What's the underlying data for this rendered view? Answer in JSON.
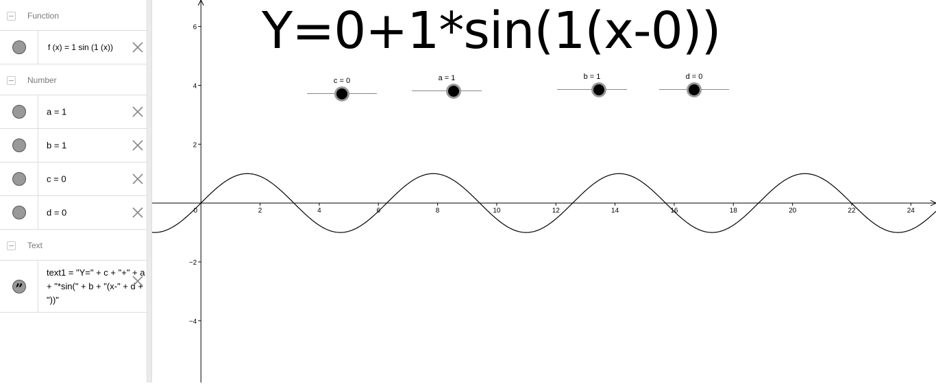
{
  "algebra": {
    "categories": {
      "function": "Function",
      "number": "Number",
      "text": "Text"
    },
    "items": {
      "f": "f (x)  =  1  sin (1  (x))",
      "a": "a = 1",
      "b": "b = 1",
      "c": "c = 0",
      "d": "d = 0",
      "text1": "text1 = \"Y=\" + c + \"+\" + a + \"*sin(\" + b + \"(x-\" + d + \"))\""
    }
  },
  "graphics": {
    "title": "Y=0+1*sin(1(x-0))",
    "sliders": {
      "c": {
        "label": "c = 0",
        "value": 0,
        "min": -5,
        "max": 5
      },
      "a": {
        "label": "a = 1",
        "value": 1,
        "min": -5,
        "max": 5
      },
      "b": {
        "label": "b = 1",
        "value": 1,
        "min": -5,
        "max": 5
      },
      "d": {
        "label": "d = 0",
        "value": 0,
        "min": -5,
        "max": 5
      }
    }
  },
  "chart_data": {
    "type": "line",
    "function": "1*sin(1*(x-0))+0",
    "params": {
      "a": 1,
      "b": 1,
      "c": 0,
      "d": 0
    },
    "xlim": [
      -1.65,
      24.85
    ],
    "ylim": [
      -6.1,
      6.9
    ],
    "x_ticks": [
      0,
      2,
      4,
      6,
      8,
      10,
      12,
      14,
      16,
      18,
      20,
      22,
      24
    ],
    "y_ticks": [
      -4,
      -2,
      2,
      4,
      6
    ],
    "x_tick_labels": [
      "0",
      "2",
      "4",
      "6",
      "8",
      "10",
      "12",
      "14",
      "16",
      "18",
      "20",
      "22",
      "24"
    ],
    "y_tick_labels": [
      "−4",
      "−2",
      "2",
      "4",
      "6"
    ],
    "grid": false
  }
}
